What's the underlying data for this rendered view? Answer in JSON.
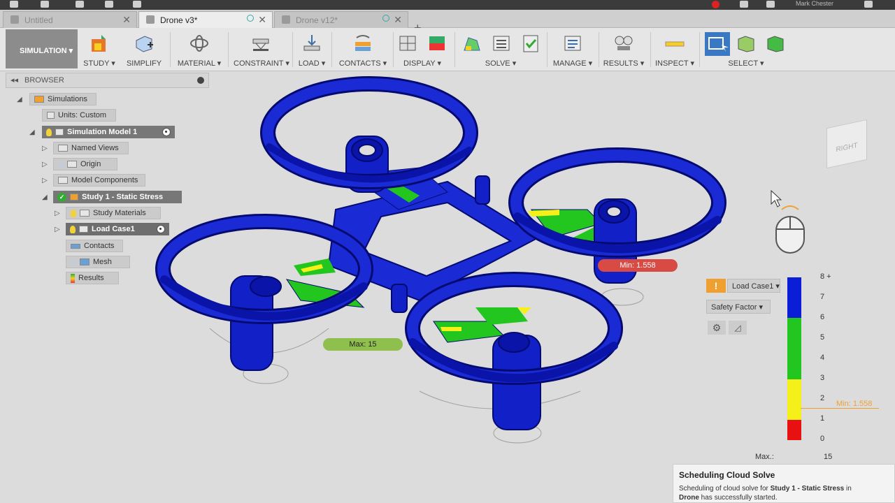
{
  "app": {
    "user": "Mark Chester"
  },
  "tabs": [
    {
      "label": "Untitled",
      "active": false
    },
    {
      "label": "Drone v3*",
      "active": true
    },
    {
      "label": "Drone v12*",
      "active": false
    }
  ],
  "toolbar": {
    "workspace": "SIMULATION ▾",
    "groups": [
      {
        "label": "STUDY ▾"
      },
      {
        "label": "SIMPLIFY"
      },
      {
        "label": "MATERIAL ▾"
      },
      {
        "label": "CONSTRAINT ▾"
      },
      {
        "label": "LOAD ▾"
      },
      {
        "label": "CONTACTS ▾"
      },
      {
        "label": "DISPLAY ▾"
      },
      {
        "label": "SOLVE ▾"
      },
      {
        "label": "MANAGE ▾"
      },
      {
        "label": "RESULTS ▾"
      },
      {
        "label": "INSPECT ▾"
      },
      {
        "label": "SELECT ▾"
      }
    ]
  },
  "browser": {
    "title": "BROWSER",
    "nodes": [
      {
        "label": "Simulations"
      },
      {
        "label": "Units: Custom"
      },
      {
        "label": "Simulation Model 1"
      },
      {
        "label": "Named Views"
      },
      {
        "label": "Origin"
      },
      {
        "label": "Model Components"
      },
      {
        "label": "Study 1 - Static Stress"
      },
      {
        "label": "Study Materials"
      },
      {
        "label": "Load Case1"
      },
      {
        "label": "Contacts"
      },
      {
        "label": "Mesh"
      },
      {
        "label": "Results"
      }
    ]
  },
  "viewcube": {
    "face": "RIGHT"
  },
  "probes": {
    "min": "Min: 1.558",
    "max": "Max: 15"
  },
  "legend": {
    "load_case": "Load Case1 ▾",
    "result_type": "Safety Factor ▾",
    "ticks": [
      "8 +",
      "7",
      "6",
      "5",
      "4",
      "3",
      "2",
      "1",
      "0"
    ],
    "min_marker": "Min: 1.558",
    "max_label": "Max.:",
    "max_value": "15",
    "colors": {
      "blue": "#0a1ed8",
      "green": "#22c61e",
      "yellow": "#f5ef1a",
      "red": "#e81010"
    }
  },
  "notification": {
    "title": "Scheduling Cloud Solve",
    "pre": "Scheduling of cloud solve for ",
    "study": "Study 1 - Static Stress",
    "mid": " in ",
    "design": "Drone",
    "post": " has successfully started."
  }
}
